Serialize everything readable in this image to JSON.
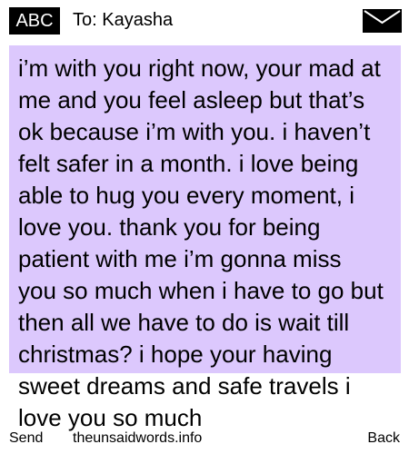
{
  "header": {
    "badge_label": "ABC",
    "recipient": "To: Kayasha",
    "icon": "envelope-icon"
  },
  "message": {
    "text": "i’m with you right now, your mad at\nme and you feel asleep but that’s\nok because i’m with you. i haven’t\nfelt safer in a month. i love being\nable to hug you every moment, i\nlove you. thank you for being\npatient with me i’m gonna miss\nyou so much when i have to go but\nthen all we have to do is wait till\nchristmas? i hope your having\nsweet dreams and safe travels i\nlove you so much",
    "highlight_color": "#dcc8fd"
  },
  "footer": {
    "send_label": "Send",
    "watermark": "theunsaidwords.info",
    "back_label": "Back"
  }
}
